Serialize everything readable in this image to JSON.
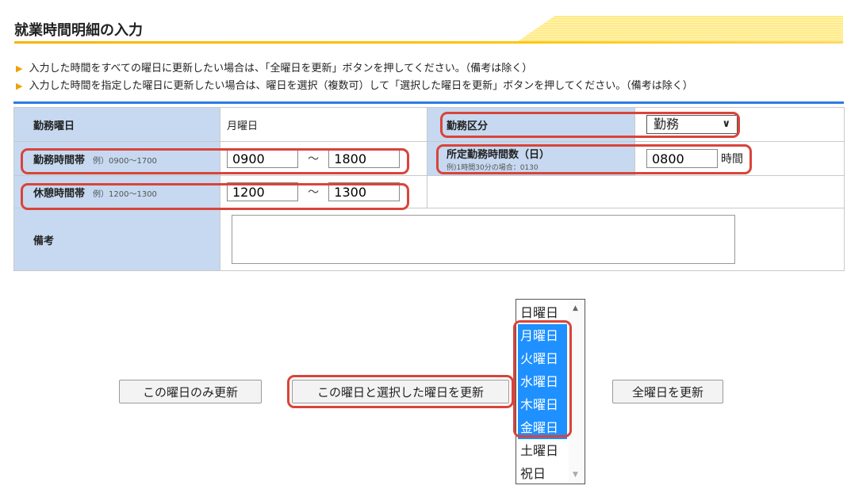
{
  "title": "就業時間明細の入力",
  "instructions": [
    "入力した時間をすべての曜日に更新したい場合は、「全曜日を更新」ボタンを押してください。（備考は除く）",
    "入力した時間を指定した曜日に更新したい場合は、曜日を選択（複数可）して「選択した曜日を更新」ボタンを押してください。（備考は除く）"
  ],
  "form": {
    "work_day": {
      "label": "勤務曜日",
      "value": "月曜日"
    },
    "work_type": {
      "label": "勤務区分",
      "value": "勤務"
    },
    "work_hours": {
      "label": "勤務時間帯",
      "example": "例）0900〜1700",
      "start": "0900",
      "tilde": "〜",
      "end": "1800"
    },
    "scheduled_hours": {
      "label": "所定勤務時間数（日）",
      "example": "例)1時間30分の場合：0130",
      "value": "0800",
      "unit": "時間"
    },
    "break_hours": {
      "label": "休憩時間帯",
      "example": "例）1200〜1300",
      "start": "1200",
      "tilde": "〜",
      "end": "1300"
    },
    "remarks": {
      "label": "備考",
      "value": ""
    }
  },
  "buttons": {
    "update_this_day": "この曜日のみ更新",
    "update_selected": "この曜日と選択した曜日を更新",
    "update_all": "全曜日を更新"
  },
  "weekday_list": {
    "options": [
      "日曜日",
      "月曜日",
      "火曜日",
      "水曜日",
      "木曜日",
      "金曜日",
      "土曜日",
      "祝日"
    ],
    "selected": [
      "月曜日",
      "火曜日",
      "水曜日",
      "木曜日",
      "金曜日"
    ]
  },
  "colors": {
    "highlight": "#d9443a",
    "selection": "#1e90ff",
    "label_bg": "#c6d9f0",
    "accent_bar": "#2c7be5"
  }
}
